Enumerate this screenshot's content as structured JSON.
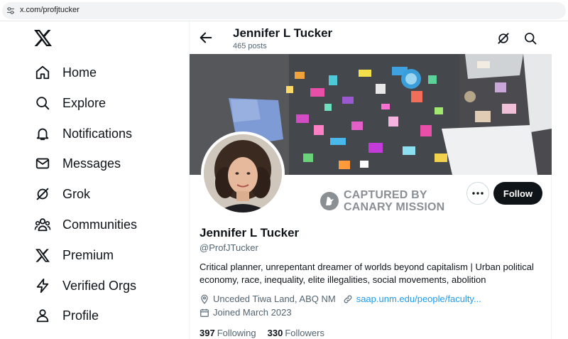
{
  "browser": {
    "url": "x.com/profjtucker"
  },
  "nav": {
    "items": [
      {
        "label": "Home",
        "icon": "home-icon"
      },
      {
        "label": "Explore",
        "icon": "search-icon"
      },
      {
        "label": "Notifications",
        "icon": "bell-icon"
      },
      {
        "label": "Messages",
        "icon": "mail-icon"
      },
      {
        "label": "Grok",
        "icon": "grok-icon"
      },
      {
        "label": "Communities",
        "icon": "people-icon"
      },
      {
        "label": "Premium",
        "icon": "x-logo-icon"
      },
      {
        "label": "Verified Orgs",
        "icon": "lightning-icon"
      },
      {
        "label": "Profile",
        "icon": "person-icon"
      }
    ]
  },
  "header": {
    "name": "Jennifer L Tucker",
    "posts": "465 posts"
  },
  "profile": {
    "name": "Jennifer L Tucker",
    "handle": "@ProfJTucker",
    "bio": "Critical planner, unrepentant dreamer of worlds beyond capitalism | Urban political economy, race, inequality, elite illegalities, social movements, abolition",
    "location": "Unceded Tiwa Land, ABQ NM",
    "website": "saap.unm.edu/people/faculty...",
    "joined": "Joined March 2023",
    "following_count": "397",
    "following_label": "Following",
    "followers_count": "330",
    "followers_label": "Followers",
    "follow_label": "Follow"
  },
  "watermark": {
    "line1": "CAPTURED BY",
    "line2": "CANARY MISSION"
  },
  "colors": {
    "text": "#0f1419",
    "secondary": "#536471",
    "link": "#1d9bf0",
    "follow_bg": "#0f1419"
  }
}
